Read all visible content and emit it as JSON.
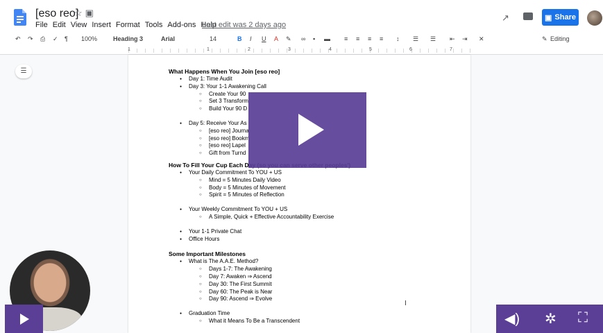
{
  "doc": {
    "title": "[eso reo]",
    "menu": [
      "File",
      "Edit",
      "View",
      "Insert",
      "Format",
      "Tools",
      "Add-ons",
      "Help"
    ],
    "last_edit": "Last edit was 2 days ago",
    "share_label": "Share",
    "accent": "#1a73e8"
  },
  "toolbar": {
    "zoom": "100%",
    "style": "Heading 3",
    "font": "Arial",
    "size": "14",
    "mode": "Editing"
  },
  "ruler": [
    "1",
    "1",
    "2",
    "3",
    "4",
    "5",
    "6",
    "7"
  ],
  "content": {
    "lines": [
      {
        "t": "h",
        "text": "What Happens When You Join [eso reo]"
      },
      {
        "t": "l1",
        "text": "Day 1: Time Audit"
      },
      {
        "t": "l1",
        "text": "Day 3: Your 1-1 Awakening Call"
      },
      {
        "t": "l2",
        "text": "Create Your 90"
      },
      {
        "t": "l2",
        "text": "Set 3 Transform"
      },
      {
        "t": "l2",
        "text": "Build Your 90 D"
      },
      {
        "t": "gap"
      },
      {
        "t": "l1",
        "text": "Day 5: Receive Your As"
      },
      {
        "t": "l2",
        "text": "[eso reo] Journa"
      },
      {
        "t": "l2",
        "text": "[eso reo] Bookm"
      },
      {
        "t": "l2",
        "text": "[eso reo] Lapel"
      },
      {
        "t": "l2",
        "text": "Gift from Turnd"
      },
      {
        "t": "gap-s"
      },
      {
        "t": "h",
        "text": "How To Fill Your Cup Each Day (so you can serve other peoples')"
      },
      {
        "t": "l1",
        "text": "Your Daily Commitment To YOU + US"
      },
      {
        "t": "l2",
        "text": "Mind = 5 Minutes Daily Video"
      },
      {
        "t": "l2",
        "text": "Body = 5 Minutes of Movement"
      },
      {
        "t": "l2",
        "text": "Spirit = 5 Minutes of Reflection"
      },
      {
        "t": "gap"
      },
      {
        "t": "l1",
        "text": "Your Weekly  Commitment To YOU + US"
      },
      {
        "t": "l2",
        "text": "A Simple, Quick + Effective Accountability Exercise"
      },
      {
        "t": "gap"
      },
      {
        "t": "l1",
        "text": "Your 1-1 Private Chat"
      },
      {
        "t": "l1",
        "text": "Office Hours"
      },
      {
        "t": "gap"
      },
      {
        "t": "h",
        "text": "Some Important Milestones"
      },
      {
        "t": "l1",
        "text": "What is The A.A.E. Method?"
      },
      {
        "t": "l2",
        "text": "Days 1-7: The Awakening"
      },
      {
        "t": "l2",
        "text": "Day 7: Awaken ⇒ Ascend"
      },
      {
        "t": "l2",
        "text": "Day 30: The First Summit"
      },
      {
        "t": "l2",
        "text": "Day 60: The Peak is Near"
      },
      {
        "t": "l2",
        "text": "Day 90: Ascend ⇒ Evolve"
      },
      {
        "t": "gap"
      },
      {
        "t": "l1",
        "text": "Graduation Time"
      },
      {
        "t": "l2",
        "text": "What it Means To Be a Transcendent"
      }
    ]
  },
  "video": {
    "overlay_color": "#5b3f97",
    "icons": [
      "play-icon",
      "volume-icon",
      "settings-icon",
      "fullscreen-icon"
    ]
  }
}
